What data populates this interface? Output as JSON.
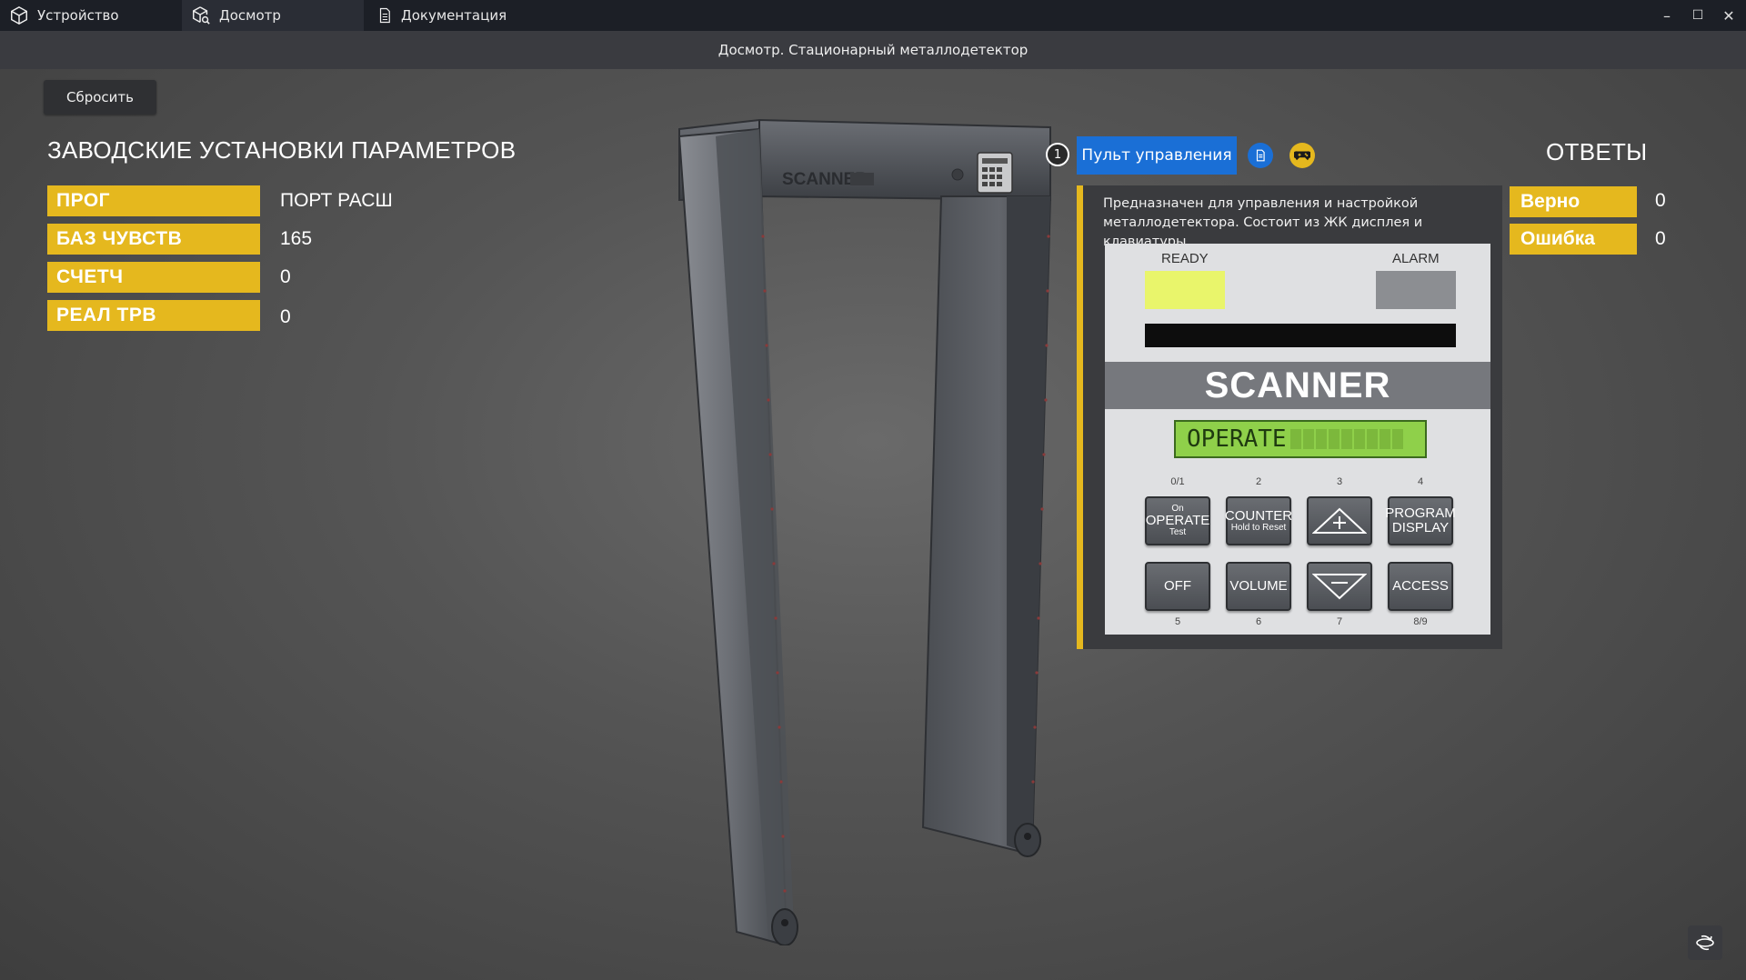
{
  "tabs": [
    {
      "label": "Устройство",
      "icon": "cube-icon"
    },
    {
      "label": "Досмотр",
      "icon": "cube-search-icon"
    },
    {
      "label": "Документация",
      "icon": "document-icon"
    }
  ],
  "window_controls": {
    "minimize": "–",
    "maximize": "☐",
    "close": "✕"
  },
  "title": "Досмотр. Стационарный металлодетектор",
  "reset_label": "Сбросить",
  "factory": {
    "title": "ЗАВОДСКИЕ УСТАНОВКИ ПАРАМЕТРОВ",
    "params": [
      {
        "label": "ПРОГ",
        "value": "ПОРТ РАСШ"
      },
      {
        "label": "БАЗ ЧУВСТВ",
        "value": "165"
      },
      {
        "label": "СЧЕТЧ",
        "value": "0"
      },
      {
        "label": "РЕАЛ ТРВ",
        "value": "0"
      }
    ]
  },
  "detector": {
    "brand": "SCANNER"
  },
  "control": {
    "step_number": "1",
    "tab_label": "Пульт управления",
    "description": "Предназначен для управления и настройкой металлодетектора. Состоит из ЖК дисплея и клавиатуры.",
    "console": {
      "ready_label": "READY",
      "alarm_label": "ALARM",
      "brand": "SCANNER",
      "lcd_text": "OPERATE",
      "keys_top": [
        {
          "num": "0/1",
          "top": "On",
          "main": "OPERATE",
          "bottom": "Test"
        },
        {
          "num": "2",
          "top": "",
          "main": "COUNTER",
          "bottom": "Hold to Reset"
        },
        {
          "num": "3",
          "top": "",
          "main": "",
          "bottom": ""
        },
        {
          "num": "4",
          "top": "",
          "main": "PROGRAM",
          "bottom": "DISPLAY"
        }
      ],
      "keys_bottom": [
        {
          "num": "5",
          "main": "OFF"
        },
        {
          "num": "6",
          "main": "VOLUME"
        },
        {
          "num": "7",
          "main": ""
        },
        {
          "num": "8/9",
          "main": "ACCESS"
        }
      ]
    }
  },
  "answers": {
    "title": "ОТВЕТЫ",
    "items": [
      {
        "label": "Верно",
        "value": "0"
      },
      {
        "label": "Ошибка",
        "value": "0"
      }
    ]
  },
  "colors": {
    "accent_yellow": "#e5b81e",
    "tab_blue": "#1a6fd6",
    "ready_light": "#e9f56b",
    "lcd_green": "#8fd04a"
  }
}
